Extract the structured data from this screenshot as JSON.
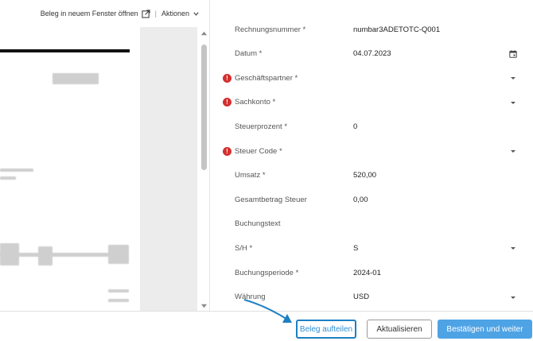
{
  "toolbar": {
    "open_new_window": "Beleg in neuem Fenster öffnen",
    "separator": "|",
    "actions": "Aktionen"
  },
  "form": {
    "fields": [
      {
        "label": "Rechnungsnummer *",
        "value": "numbar3ADETOTC-Q001",
        "error": false,
        "icon": ""
      },
      {
        "label": "Datum *",
        "value": "04.07.2023",
        "error": false,
        "icon": "calendar-icon"
      },
      {
        "label": "Geschäftspartner *",
        "value": "",
        "error": true,
        "icon": "dropdown-arrow-icon"
      },
      {
        "label": "Sachkonto *",
        "value": "",
        "error": true,
        "icon": "dropdown-arrow-icon"
      },
      {
        "label": "Steuerprozent *",
        "value": "0",
        "error": false,
        "icon": ""
      },
      {
        "label": "Steuer Code *",
        "value": "",
        "error": true,
        "icon": "dropdown-arrow-icon"
      },
      {
        "label": "Umsatz *",
        "value": "520,00",
        "error": false,
        "icon": ""
      },
      {
        "label": "Gesamtbetrag Steuer",
        "value": "0,00",
        "error": false,
        "icon": ""
      },
      {
        "label": "Buchungstext",
        "value": "",
        "error": false,
        "icon": ""
      },
      {
        "label": "S/H *",
        "value": "S",
        "error": false,
        "icon": "dropdown-arrow-icon"
      },
      {
        "label": "Buchungsperiode *",
        "value": "2024-01",
        "error": false,
        "icon": ""
      },
      {
        "label": "Währung",
        "value": "USD",
        "error": false,
        "icon": "dropdown-arrow-icon"
      }
    ],
    "error_glyph": "!"
  },
  "footer": {
    "split_label": "Beleg aufteilen",
    "refresh_label": "Aktualisieren",
    "confirm_label": "Bestätigen und weiter"
  },
  "colors": {
    "error": "#d32f2f",
    "primary": "#4ea3e5",
    "highlight_border": "#1d7fc2"
  }
}
